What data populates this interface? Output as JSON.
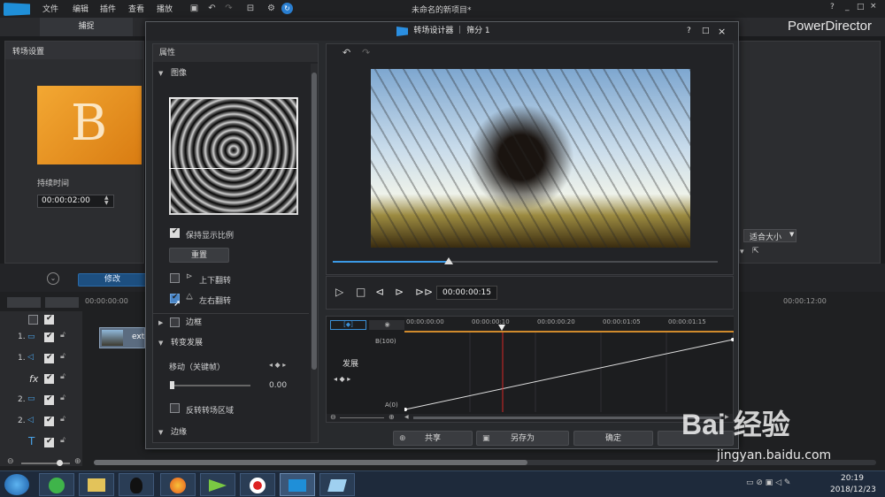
{
  "app": {
    "title": "未命名的新项目*",
    "brand": "PowerDirector",
    "menu": [
      "文件",
      "编辑",
      "插件",
      "查看",
      "播放"
    ],
    "tab_capture": "捕捉",
    "window_controls": [
      "?",
      "_",
      "□",
      "×"
    ]
  },
  "left_panel": {
    "title": "转场设置",
    "thumb_letter": "B",
    "duration_label": "持续时间",
    "duration_value": "00:00:02:00"
  },
  "right_panel": {
    "fit_label": "适合大小",
    "fit_arrow": "▼"
  },
  "timeline": {
    "modify_button": "修改",
    "time_start": "00:00:00:00",
    "time_end": "00:00:12:00",
    "tracks": [
      "1.",
      "1.",
      "fx",
      "2.",
      "2.",
      "T"
    ],
    "clip_label": "ext"
  },
  "dialog": {
    "title": "转场设计器 ｜ 筛分 1",
    "controls": [
      "?",
      "□",
      "×"
    ],
    "props_header": "属性",
    "sections": {
      "image": "图像",
      "keep_ratio": "保持显示比例",
      "reset": "重置",
      "flip_v": "上下翻转",
      "flip_h": "左右翻转",
      "border": "边框",
      "transition": "转变发展",
      "move_kf": "移动（关键帧）",
      "move_value": "0.00",
      "reverse": "反转转场区域",
      "edge": "边缘"
    },
    "playback_time": "00:00:00:15",
    "keyframe": {
      "ruler": [
        "00:00:00:00",
        "00:00:00:10",
        "00:00:00:20",
        "00:00:01:05",
        "00:00:01:15"
      ],
      "top_label": "B(100)",
      "bottom_label": "A(0)",
      "track_label": "发展"
    },
    "buttons": {
      "share": "共享",
      "save_as": "另存为",
      "ok": "确定"
    }
  },
  "taskbar": {
    "time": "20:19",
    "date": "2018/12/23"
  },
  "watermark": {
    "text": "Bai 经验",
    "url": "jingyan.baidu.com"
  }
}
